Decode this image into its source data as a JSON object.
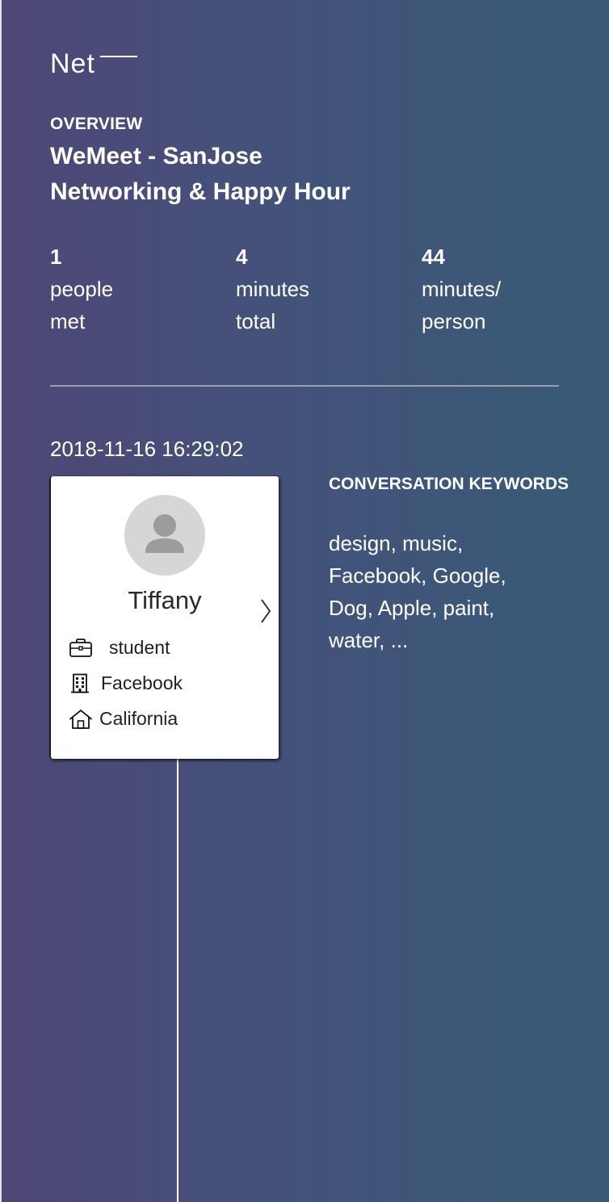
{
  "brand": {
    "name": "Net"
  },
  "overview": {
    "label": "OVERVIEW",
    "title_line1": "WeMeet - SanJose",
    "title_line2": "Networking & Happy Hour"
  },
  "stats": [
    {
      "value": "1",
      "label_line1": "people",
      "label_line2": "met"
    },
    {
      "value": "4",
      "label_line1": "minutes",
      "label_line2": "total"
    },
    {
      "value": "44",
      "label_line1": "minutes/",
      "label_line2": "person"
    }
  ],
  "timeline": {
    "entries": [
      {
        "timestamp": "2018-11-16 16:29:02",
        "contact": {
          "name": "Tiffany",
          "occupation": "student",
          "company": "Facebook",
          "location": "California",
          "avatar_icon": "person-placeholder-icon"
        },
        "keywords_label": "CONVERSATION KEYWORDS",
        "keywords_line1": "design, music,",
        "keywords_line2": "Facebook, Google,",
        "keywords_line3": "Dog, Apple, paint,",
        "keywords_line4": "water, ..."
      }
    ]
  },
  "icons": {
    "occupation": "briefcase-icon",
    "company": "building-icon",
    "location": "home-icon",
    "open": "chevron-right-icon"
  },
  "colors": {
    "gradient_left": "#4e4775",
    "gradient_right": "#385a76",
    "card_background": "#ffffff",
    "avatar_background": "#d6d6d6",
    "divider": "#9a9fae"
  }
}
